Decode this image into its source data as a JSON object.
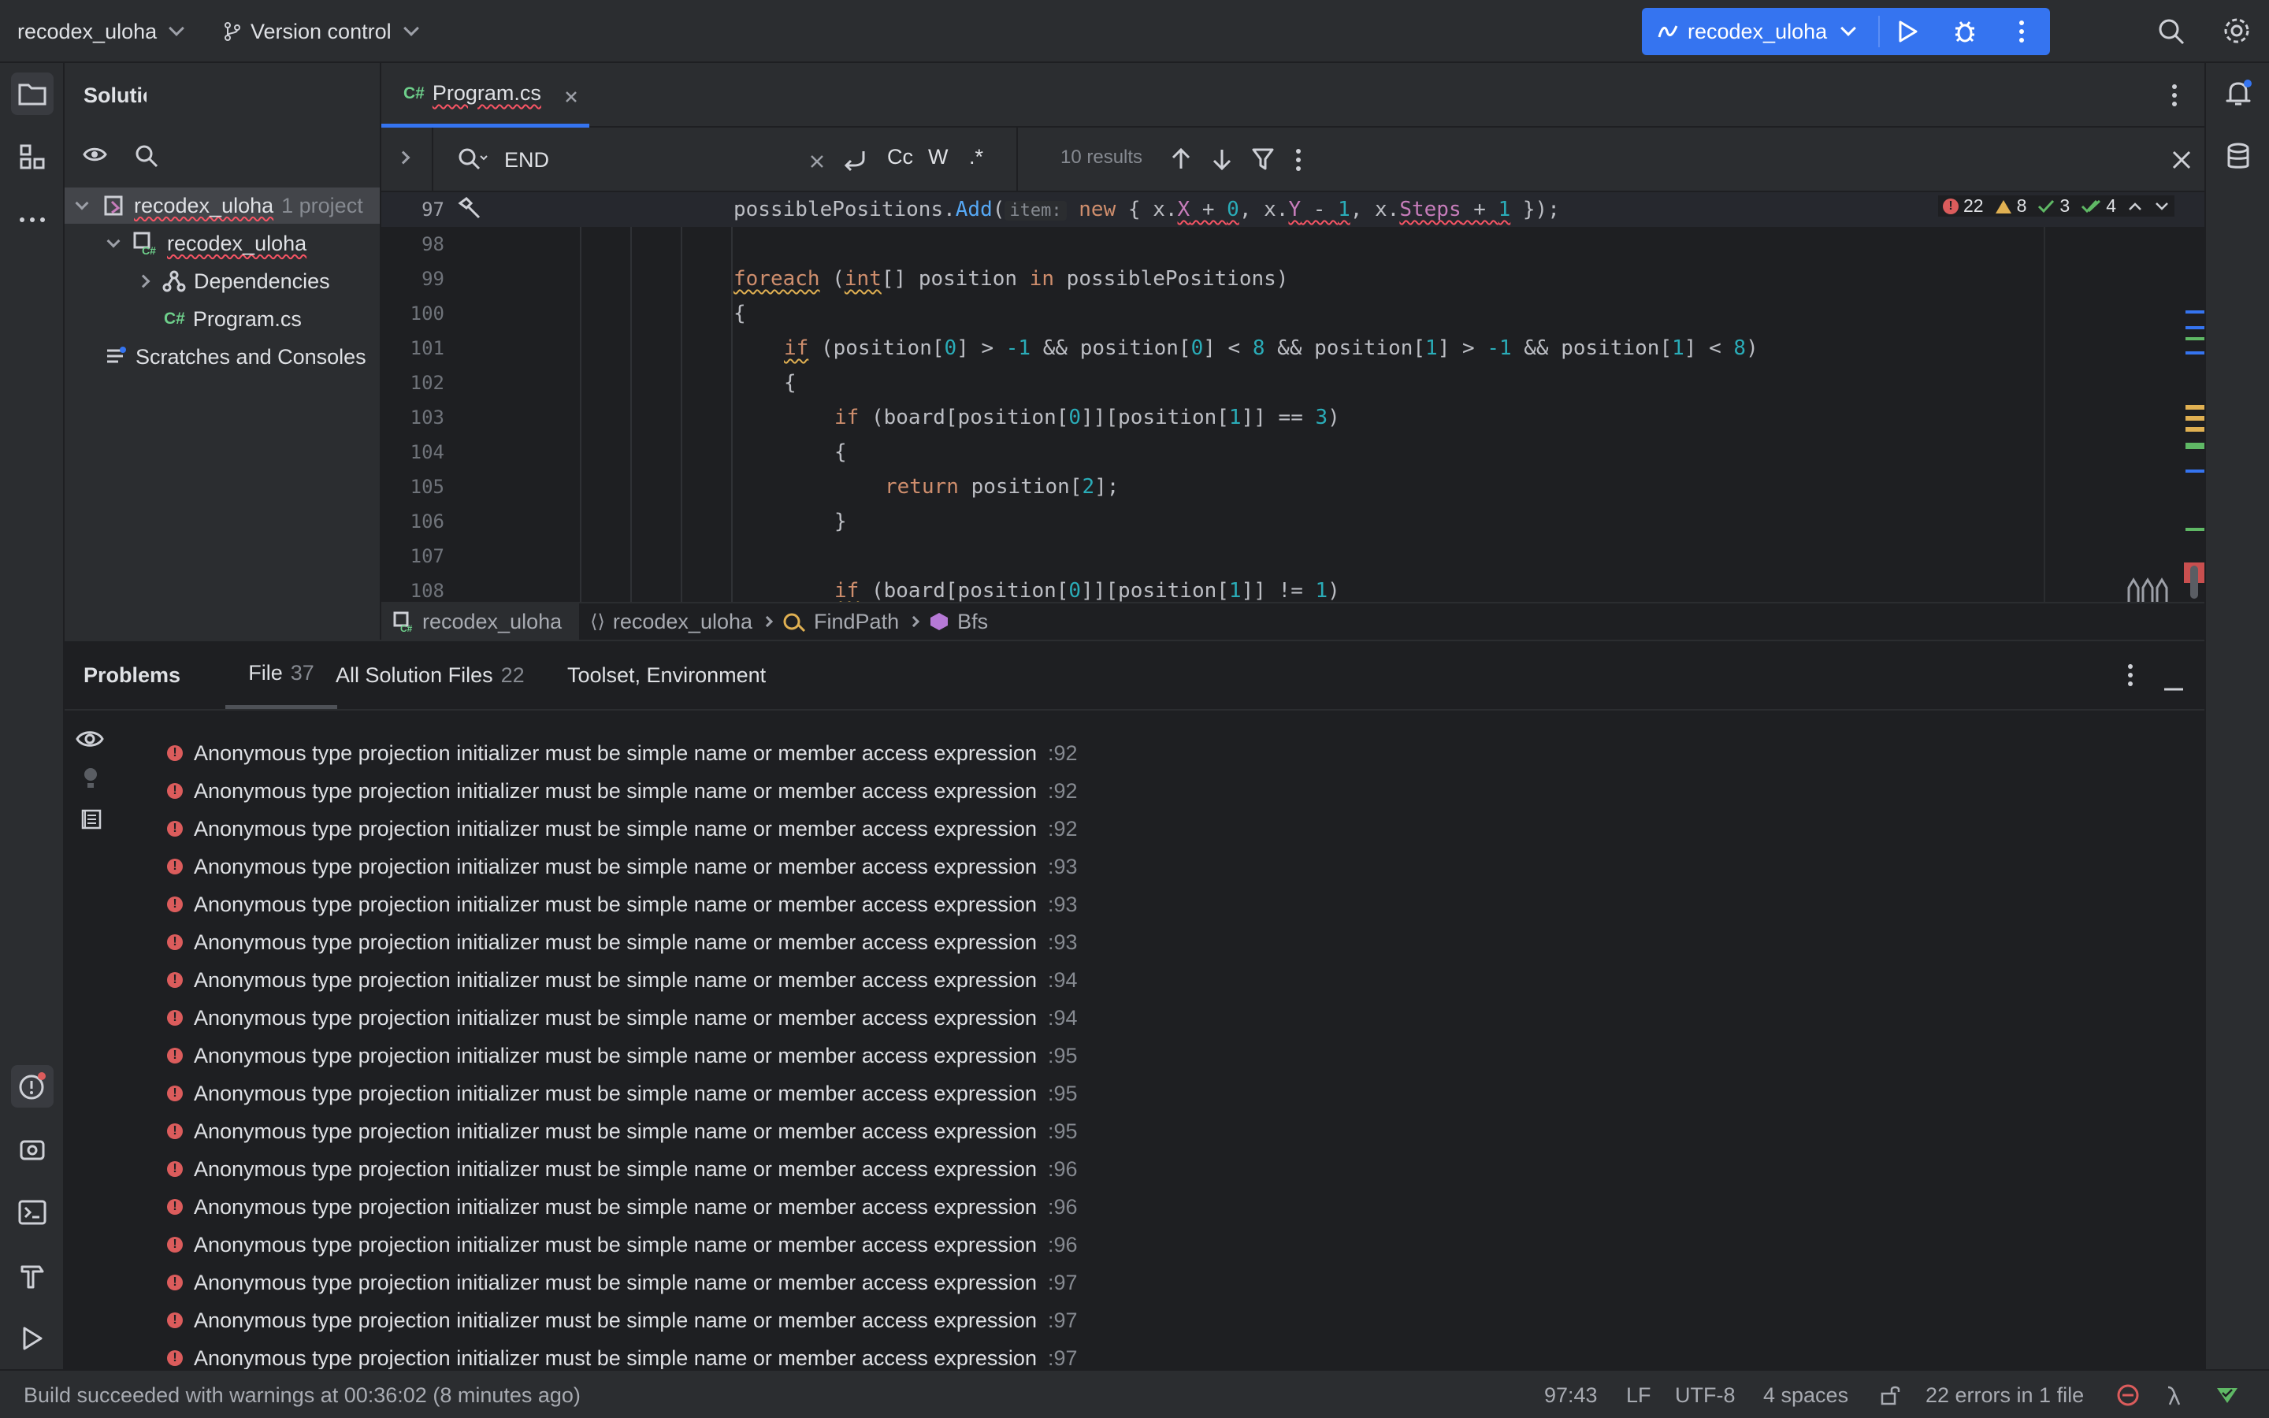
{
  "titlebar": {
    "project_name": "recodex_uloha",
    "vcs_label": "Version control",
    "run_config": "recodex_uloha"
  },
  "project_panel": {
    "title": "Solution",
    "items": [
      {
        "label": "recodex_uloha",
        "suffix": "1 project"
      },
      {
        "label": "recodex_uloha"
      },
      {
        "label": "Dependencies"
      },
      {
        "label": "Program.cs",
        "badge": "C#"
      },
      {
        "label": "Scratches and Consoles"
      }
    ]
  },
  "editor": {
    "tab": {
      "badge": "C#",
      "label": "Program.cs"
    },
    "find": {
      "query": "END",
      "case_label": "Cc",
      "word_label": "W",
      "regex_label": ".*",
      "results": "10 results"
    },
    "inspections": {
      "errors": "22",
      "warnings": "8",
      "weak": "3",
      "ok": "4"
    },
    "lines": [
      {
        "n": "97"
      },
      {
        "n": "98"
      },
      {
        "n": "99"
      },
      {
        "n": "100"
      },
      {
        "n": "101"
      },
      {
        "n": "102"
      },
      {
        "n": "103"
      },
      {
        "n": "104"
      },
      {
        "n": "105"
      },
      {
        "n": "106"
      },
      {
        "n": "107"
      },
      {
        "n": "108"
      }
    ],
    "code": {
      "l97_a": "possiblePositions.",
      "l97_fn": "Add",
      "l97_b": "(",
      "l97_hint": "item:",
      "l97_new": "new",
      "l97_c": " { x.",
      "l97_x": "X",
      "l97_d": " + ",
      "l97_0": "0",
      "l97_e": ", x.",
      "l97_y": "Y",
      "l97_f": " - ",
      "l97_1": "1",
      "l97_g": ", x.",
      "l97_steps": "Steps",
      "l97_h": " + ",
      "l97_1b": "1",
      "l97_i": " });",
      "l99_kw": "foreach",
      "l99_a": " (",
      "l99_int": "int",
      "l99_b": "[] position ",
      "l99_in": "in",
      "l99_c": " possiblePositions)",
      "l100": "{",
      "l101_if": "if",
      "l101_a": " (position[",
      "l101_n0": "0",
      "l101_b": "] > ",
      "l101_m1": "-1",
      "l101_c": " && position[",
      "l101_n0b": "0",
      "l101_d": "] < ",
      "l101_n8": "8",
      "l101_e": " && position[",
      "l101_n1": "1",
      "l101_f": "] > ",
      "l101_m1b": "-1",
      "l101_g": " && position[",
      "l101_n1b": "1",
      "l101_h": "] < ",
      "l101_n8b": "8",
      "l101_i": ")",
      "l102": "{",
      "l103_if": "if",
      "l103_a": " (board[position[",
      "l103_n0": "0",
      "l103_b": "]][position[",
      "l103_n1": "1",
      "l103_c": "]] == ",
      "l103_n3": "3",
      "l103_d": ")",
      "l104": "{",
      "l105_kw": "return",
      "l105_a": " position[",
      "l105_n2": "2",
      "l105_b": "];",
      "l106": "}",
      "l108_if": "if",
      "l108_a": " (board[position[",
      "l108_n0": "0",
      "l108_b": "]][position[",
      "l108_n1": "1",
      "l108_c": "]] != ",
      "l108_n1b": "1",
      "l108_d": ")"
    },
    "breadcrumbs": [
      "recodex_uloha",
      "recodex_uloha",
      "FindPath",
      "Bfs"
    ]
  },
  "problems": {
    "title": "Problems",
    "tabs": [
      {
        "label": "File",
        "count": "37"
      },
      {
        "label": "All Solution Files",
        "count": "22"
      },
      {
        "label": "Toolset, Environment",
        "count": ""
      }
    ],
    "message": "Anonymous type projection initializer must be simple name or member access expression",
    "rows": [
      ":92",
      ":92",
      ":92",
      ":93",
      ":93",
      ":93",
      ":94",
      ":94",
      ":95",
      ":95",
      ":95",
      ":96",
      ":96",
      ":96",
      ":97",
      ":97",
      ":97"
    ]
  },
  "statusbar": {
    "build": "Build succeeded with warnings at 00:36:02  (8 minutes ago)",
    "position": "97:43",
    "line_sep": "LF",
    "encoding": "UTF-8",
    "indent": "4 spaces",
    "errors": "22 errors in 1 file"
  },
  "colors": {
    "accent": "#3574f0",
    "error": "#db5c5c",
    "warning": "#e0b052",
    "ok": "#5fb865"
  }
}
